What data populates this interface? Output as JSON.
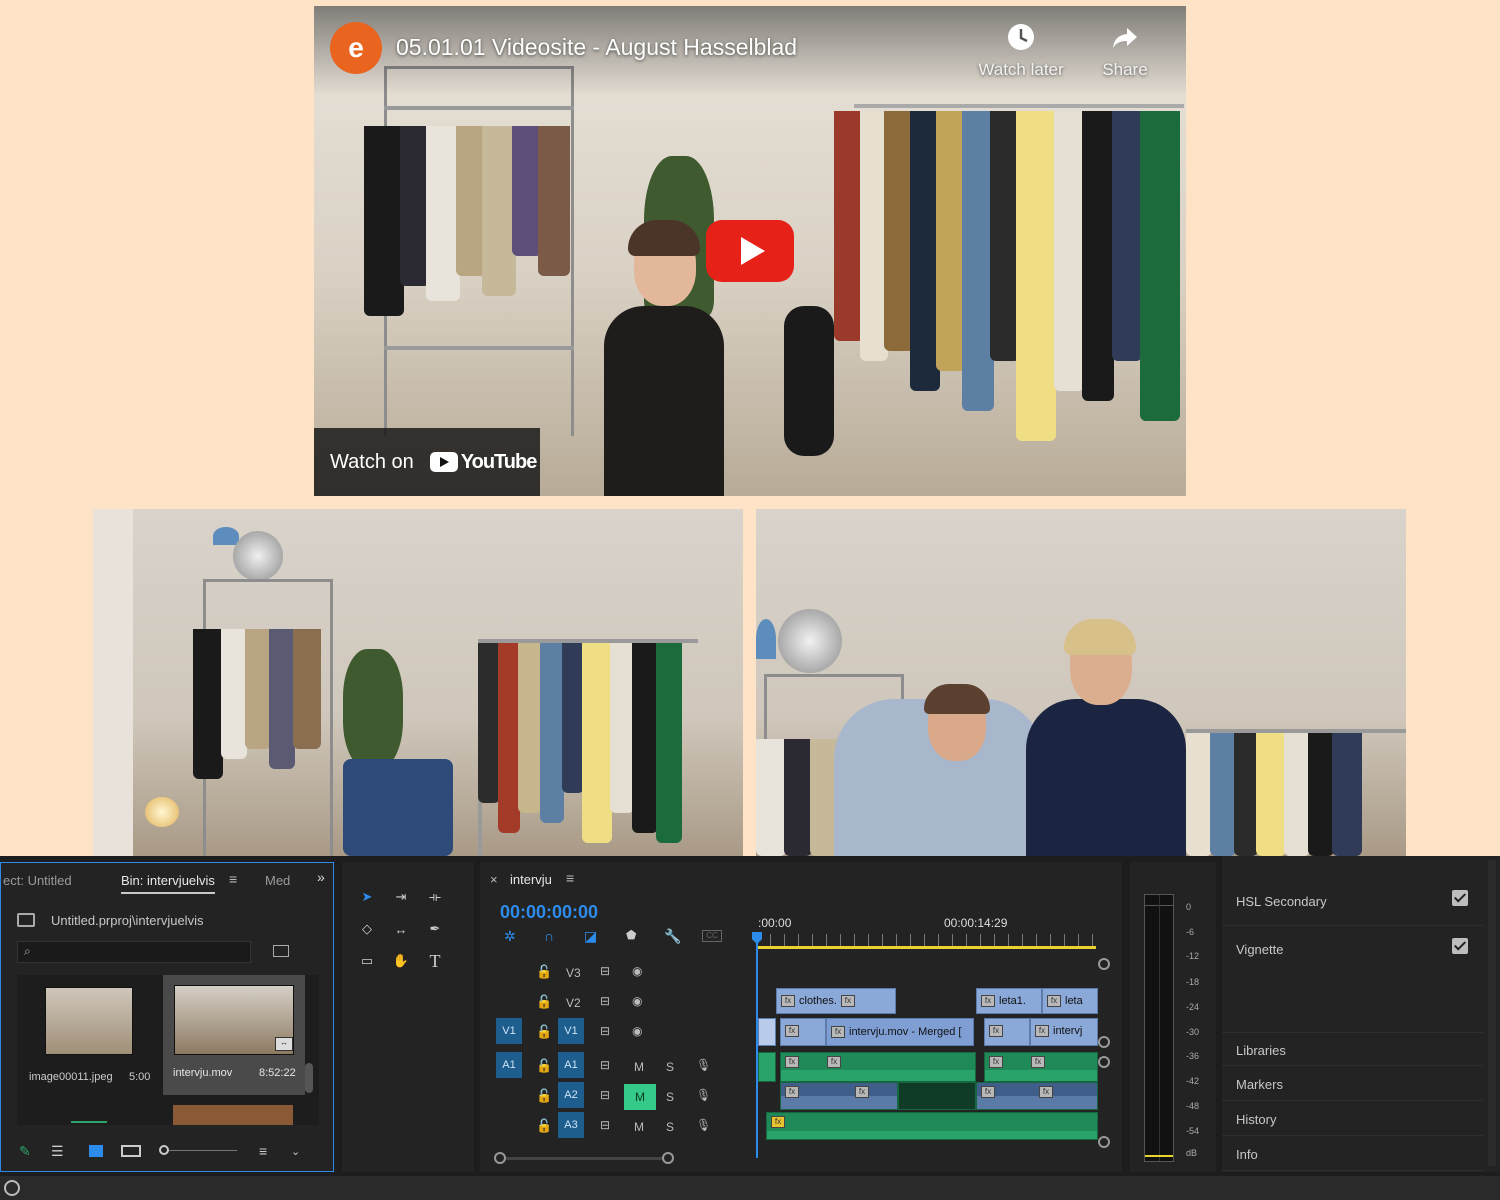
{
  "youtube": {
    "channel_initial": "e",
    "title": "05.01.01 Videosite - August Hasselblad",
    "watch_later": "Watch later",
    "share": "Share",
    "watch_on": "Watch on",
    "yt_logo": "YouTube"
  },
  "project_panel": {
    "tab_project": "ect: Untitled",
    "tab_bin": "Bin: intervjuelvis",
    "tab_media": "Med",
    "path": "Untitled.prproj\\intervjuelvis",
    "items": [
      {
        "name": "image00011.jpeg",
        "duration": "5:00"
      },
      {
        "name": "intervju.mov",
        "duration": "8:52:22"
      }
    ]
  },
  "timeline": {
    "sequence_name": "intervju",
    "timecode": "00:00:00:00",
    "ruler_start": ":00:00",
    "ruler_mid": "00:00:14:29",
    "tracks": {
      "v3": "V3",
      "v2": "V2",
      "v1": "V1",
      "v1_src": "V1",
      "a1": "A1",
      "a1_src": "A1",
      "a2": "A2",
      "a3": "A3",
      "m": "M",
      "s": "S"
    },
    "clips": {
      "v2_a": "clothes.",
      "v2_b": "leta1.",
      "v2_c": "leta",
      "v1_a": "intervju.mov - Merged [",
      "v1_b": "intervj"
    }
  },
  "meter": {
    "labels": [
      "0",
      "-6",
      "-12",
      "-18",
      "-24",
      "-30",
      "-36",
      "-42",
      "-48",
      "-54",
      "dB"
    ]
  },
  "right_panel": {
    "hsl_secondary": "HSL Secondary",
    "vignette": "Vignette",
    "libraries": "Libraries",
    "markers": "Markers",
    "history": "History",
    "info": "Info"
  },
  "colors": {
    "page_bg": "#ffe3c6",
    "accent_blue": "#2d8ceb",
    "audio_green": "#1f8a58",
    "video_clip": "#8aa8d8",
    "youtube_red": "#e62117"
  }
}
